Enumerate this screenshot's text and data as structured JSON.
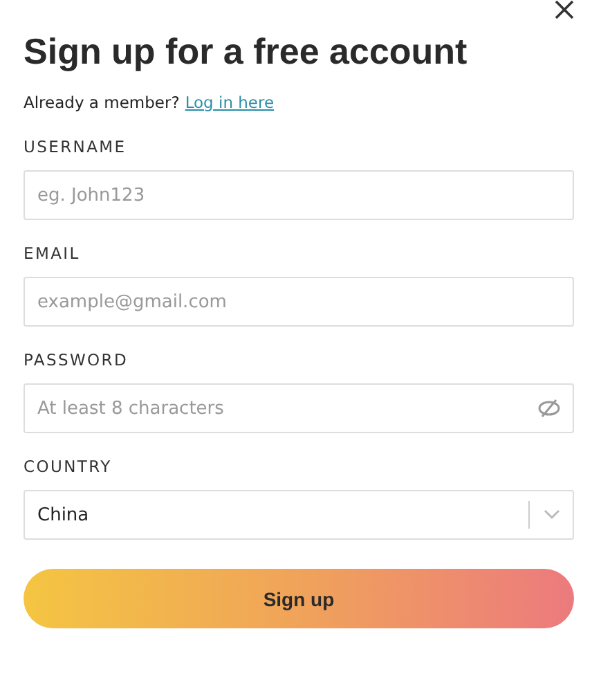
{
  "title": "Sign up for a free account",
  "member_prompt": {
    "text": "Already a member?",
    "link": "Log in here"
  },
  "fields": [
    {
      "kind": "text",
      "label": "USERNAME",
      "placeholder": "eg. John123"
    },
    {
      "kind": "text",
      "label": "EMAIL",
      "placeholder": "example@gmail.com"
    },
    {
      "kind": "password",
      "label": "PASSWORD",
      "placeholder": "At least 8 characters"
    },
    {
      "kind": "select",
      "label": "COUNTRY",
      "value": "China"
    }
  ],
  "submit": "Sign up"
}
